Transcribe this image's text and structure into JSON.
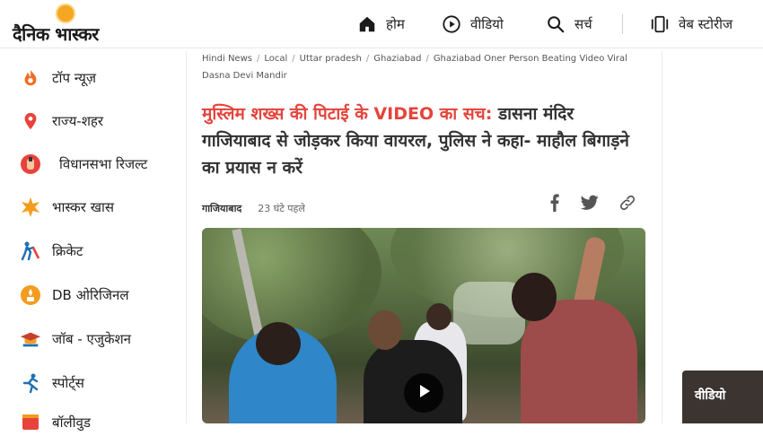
{
  "header": {
    "logo_text": "दैनिक भास्कर",
    "nav": [
      {
        "label": "होम",
        "icon": "home-icon"
      },
      {
        "label": "वीडियो",
        "icon": "play-circle-icon"
      },
      {
        "label": "सर्च",
        "icon": "search-icon"
      },
      {
        "label": "वेब स्टोरीज",
        "icon": "web-stories-icon"
      }
    ]
  },
  "sidebar": {
    "items": [
      {
        "label": "टॉप न्यूज़",
        "icon": "flame-icon",
        "color": "#f26b22"
      },
      {
        "label": "राज्य-शहर",
        "icon": "location-pin-icon",
        "color": "#e8433b"
      },
      {
        "label": "विधानसभा रिजल्ट",
        "icon": "ballot-icon",
        "color": "#e8433b"
      },
      {
        "label": "भास्कर खास",
        "icon": "star-burst-icon",
        "color": "#f39c1f"
      },
      {
        "label": "क्रिकेट",
        "icon": "cricket-icon",
        "color": "#1f6fb3"
      },
      {
        "label": "DB ओरिजिनल",
        "icon": "db-original-icon",
        "color": "#f39c1f"
      },
      {
        "label": "जॉब - एजुकेशन",
        "icon": "graduation-cap-icon",
        "color": "#c8402d"
      },
      {
        "label": "स्पोर्ट्स",
        "icon": "runner-icon",
        "color": "#1f6fb3"
      },
      {
        "label": "बॉलीवुड",
        "icon": "film-icon",
        "color": "#e8433b"
      }
    ]
  },
  "breadcrumb": [
    "Hindi News",
    "Local",
    "Uttar pradesh",
    "Ghaziabad",
    "Ghaziabad Oner Person Beating Video Viral Dasna Devi Mandir"
  ],
  "article": {
    "headline_highlight": "मुस्लिम शख्स की पिटाई के VIDEO का सच:",
    "headline_rest": " डासना मंदिर गाजियाबाद से जोड़कर किया वायरल, पुलिस ने कहा- माहौल बिगाड़ने का प्रयास न करें",
    "place": "गाजियाबाद",
    "time": "23 घंटे पहले",
    "share_icons": [
      "facebook-icon",
      "twitter-icon",
      "link-icon"
    ]
  },
  "right_widget": {
    "label": "वीडियो"
  },
  "colors": {
    "accent_red": "#e4443c",
    "brand_orange": "#f5a623"
  }
}
